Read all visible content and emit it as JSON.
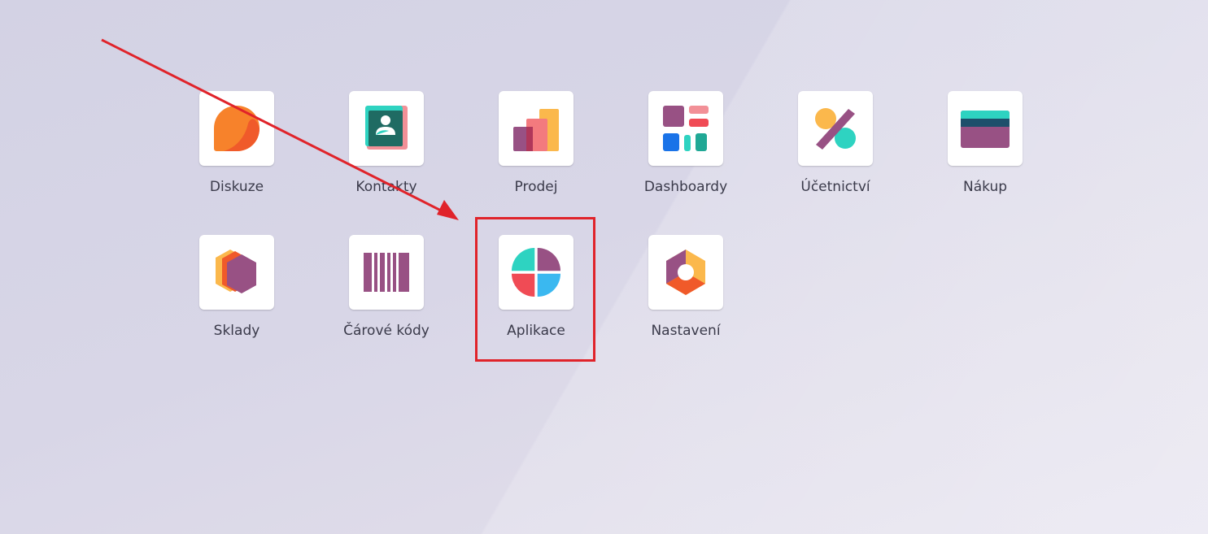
{
  "apps": [
    {
      "id": "diskuze",
      "label": "Diskuze",
      "icon": "discuss-icon"
    },
    {
      "id": "kontakty",
      "label": "Kontakty",
      "icon": "contacts-icon"
    },
    {
      "id": "prodej",
      "label": "Prodej",
      "icon": "sales-icon"
    },
    {
      "id": "dashboardy",
      "label": "Dashboardy",
      "icon": "dashboards-icon"
    },
    {
      "id": "ucetnictvi",
      "label": "Účetnictví",
      "icon": "accounting-icon"
    },
    {
      "id": "nakup",
      "label": "Nákup",
      "icon": "purchase-icon"
    },
    {
      "id": "sklady",
      "label": "Sklady",
      "icon": "inventory-icon"
    },
    {
      "id": "carove-kody",
      "label": "Čárové kódy",
      "icon": "barcode-icon"
    },
    {
      "id": "aplikace",
      "label": "Aplikace",
      "icon": "apps-icon"
    },
    {
      "id": "nastaveni",
      "label": "Nastavení",
      "icon": "settings-icon"
    }
  ],
  "colors": {
    "annotation": "#e0232a",
    "orange": "#f7822b",
    "purple": "#985184",
    "teal": "#2ed3c1",
    "red": "#f04b55",
    "blue": "#3ab8f0",
    "yellow": "#fbb84c"
  }
}
